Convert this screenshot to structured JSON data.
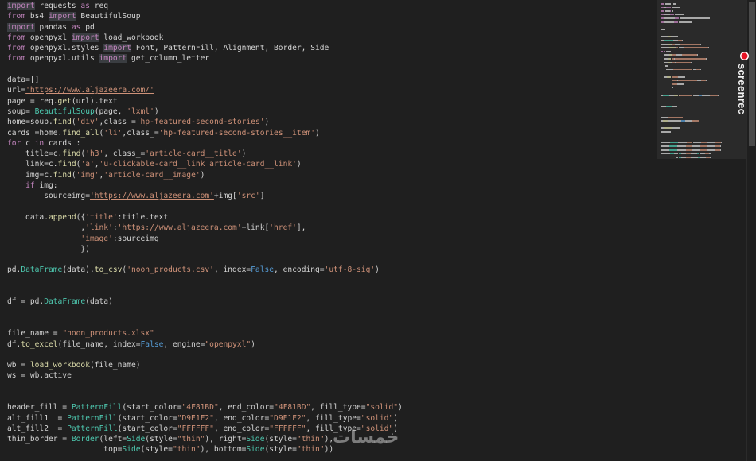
{
  "colors": {
    "background": "#1f1f1f",
    "keyword": "#c586c0",
    "string": "#ce9178",
    "function": "#dcdcaa",
    "variable": "#9cdcfe",
    "class": "#4ec9b0",
    "boolean": "#569cd6",
    "plain": "#d4d4d4",
    "rec_red": "#e81123"
  },
  "editor": {
    "lines": [
      [
        [
          "kw-hl",
          "import"
        ],
        [
          "plain",
          " requests "
        ],
        [
          "kw",
          "as"
        ],
        [
          "plain",
          " req"
        ]
      ],
      [
        [
          "kw",
          "from"
        ],
        [
          "plain",
          " bs4 "
        ],
        [
          "kw-hl",
          "import"
        ],
        [
          "plain",
          " BeautifulSoup"
        ]
      ],
      [
        [
          "kw-hl",
          "import"
        ],
        [
          "plain",
          " pandas "
        ],
        [
          "kw",
          "as"
        ],
        [
          "plain",
          " pd"
        ]
      ],
      [
        [
          "kw",
          "from"
        ],
        [
          "plain",
          " openpyxl "
        ],
        [
          "kw-hl",
          "import"
        ],
        [
          "plain",
          " load_workbook"
        ]
      ],
      [
        [
          "kw",
          "from"
        ],
        [
          "plain",
          " openpyxl.styles "
        ],
        [
          "kw-hl",
          "import"
        ],
        [
          "plain",
          " Font, PatternFill, Alignment, Border, Side"
        ]
      ],
      [
        [
          "kw",
          "from"
        ],
        [
          "plain",
          " openpyxl.utils "
        ],
        [
          "kw-hl",
          "import"
        ],
        [
          "plain",
          " get_column_letter"
        ]
      ],
      [],
      [
        [
          "plain",
          "data=[]"
        ]
      ],
      [
        [
          "plain",
          "url="
        ],
        [
          "url",
          "'https://www.aljazeera.com/'"
        ]
      ],
      [
        [
          "plain",
          "page = req."
        ],
        [
          "fn",
          "get"
        ],
        [
          "plain",
          "(url).text"
        ]
      ],
      [
        [
          "plain",
          "soup= "
        ],
        [
          "cls",
          "BeautifulSoup"
        ],
        [
          "plain",
          "(page, "
        ],
        [
          "str",
          "'lxml'"
        ],
        [
          "plain",
          ")"
        ]
      ],
      [
        [
          "plain",
          "home=soup."
        ],
        [
          "fn",
          "find"
        ],
        [
          "plain",
          "("
        ],
        [
          "str",
          "'div'"
        ],
        [
          "plain",
          ",class_="
        ],
        [
          "str",
          "'hp-featured-second-stories'"
        ],
        [
          "plain",
          ")"
        ]
      ],
      [
        [
          "plain",
          "cards =home."
        ],
        [
          "fn",
          "find_all"
        ],
        [
          "plain",
          "("
        ],
        [
          "str",
          "'li'"
        ],
        [
          "plain",
          ",class_="
        ],
        [
          "str",
          "'hp-featured-second-stories__item'"
        ],
        [
          "plain",
          ")"
        ]
      ],
      [
        [
          "kwflow",
          "for"
        ],
        [
          "plain",
          " c "
        ],
        [
          "kwflow",
          "in"
        ],
        [
          "plain",
          " cards :"
        ]
      ],
      [
        [
          "plain",
          "    title=c."
        ],
        [
          "fn",
          "find"
        ],
        [
          "plain",
          "("
        ],
        [
          "str",
          "'h3'"
        ],
        [
          "plain",
          ", class_="
        ],
        [
          "str",
          "'article-card__title'"
        ],
        [
          "plain",
          ")"
        ]
      ],
      [
        [
          "plain",
          "    link=c."
        ],
        [
          "fn",
          "find"
        ],
        [
          "plain",
          "("
        ],
        [
          "str",
          "'a'"
        ],
        [
          "plain",
          ","
        ],
        [
          "str",
          "'u-clickable-card__link article-card__link'"
        ],
        [
          "plain",
          ")"
        ]
      ],
      [
        [
          "plain",
          "    img=c."
        ],
        [
          "fn",
          "find"
        ],
        [
          "plain",
          "("
        ],
        [
          "str",
          "'img'"
        ],
        [
          "plain",
          ","
        ],
        [
          "str",
          "'article-card__image'"
        ],
        [
          "plain",
          ")"
        ]
      ],
      [
        [
          "plain",
          "    "
        ],
        [
          "kwflow",
          "if"
        ],
        [
          "plain",
          " img:"
        ]
      ],
      [
        [
          "plain",
          "        sourceimg="
        ],
        [
          "url",
          "'https://www.aljazeera.com'"
        ],
        [
          "plain",
          "+img["
        ],
        [
          "str",
          "'src'"
        ],
        [
          "plain",
          "]"
        ]
      ],
      [],
      [
        [
          "plain",
          "    data."
        ],
        [
          "fn",
          "append"
        ],
        [
          "plain",
          "({"
        ],
        [
          "str",
          "'title'"
        ],
        [
          "plain",
          ":title.text"
        ]
      ],
      [
        [
          "plain",
          "                ,"
        ],
        [
          "str",
          "'link'"
        ],
        [
          "plain",
          ":"
        ],
        [
          "url",
          "'https://www.aljazeera.com'"
        ],
        [
          "plain",
          "+link["
        ],
        [
          "str",
          "'href'"
        ],
        [
          "plain",
          "],"
        ]
      ],
      [
        [
          "plain",
          "                "
        ],
        [
          "str",
          "'image'"
        ],
        [
          "plain",
          ":sourceimg"
        ]
      ],
      [
        [
          "plain",
          "                })"
        ]
      ],
      [],
      [
        [
          "plain",
          "pd."
        ],
        [
          "cls",
          "DataFrame"
        ],
        [
          "plain",
          "(data)."
        ],
        [
          "fn",
          "to_csv"
        ],
        [
          "plain",
          "("
        ],
        [
          "str",
          "'noon_products.csv'"
        ],
        [
          "plain",
          ", index="
        ],
        [
          "bool",
          "False"
        ],
        [
          "plain",
          ", encoding="
        ],
        [
          "str",
          "'utf-8-sig'"
        ],
        [
          "plain",
          ")"
        ]
      ],
      [],
      [],
      [
        [
          "plain",
          "df = pd."
        ],
        [
          "cls",
          "DataFrame"
        ],
        [
          "plain",
          "(data)"
        ]
      ],
      [],
      [],
      [
        [
          "plain",
          "file_name = "
        ],
        [
          "str",
          "\"noon_products.xlsx\""
        ]
      ],
      [
        [
          "plain",
          "df."
        ],
        [
          "fn",
          "to_excel"
        ],
        [
          "plain",
          "(file_name, index="
        ],
        [
          "bool",
          "False"
        ],
        [
          "plain",
          ", engine="
        ],
        [
          "str",
          "\"openpyxl\""
        ],
        [
          "plain",
          ")"
        ]
      ],
      [],
      [
        [
          "plain",
          "wb = "
        ],
        [
          "fn",
          "load_workbook"
        ],
        [
          "plain",
          "(file_name)"
        ]
      ],
      [
        [
          "plain",
          "ws = wb.active"
        ]
      ],
      [],
      [],
      [
        [
          "plain",
          "header_fill = "
        ],
        [
          "cls",
          "PatternFill"
        ],
        [
          "plain",
          "(start_color="
        ],
        [
          "str",
          "\"4F81BD\""
        ],
        [
          "plain",
          ", end_color="
        ],
        [
          "str",
          "\"4F81BD\""
        ],
        [
          "plain",
          ", fill_type="
        ],
        [
          "str",
          "\"solid\""
        ],
        [
          "plain",
          ")"
        ]
      ],
      [
        [
          "plain",
          "alt_fill1  = "
        ],
        [
          "cls",
          "PatternFill"
        ],
        [
          "plain",
          "(start_color="
        ],
        [
          "str",
          "\"D9E1F2\""
        ],
        [
          "plain",
          ", end_color="
        ],
        [
          "str",
          "\"D9E1F2\""
        ],
        [
          "plain",
          ", fill_type="
        ],
        [
          "str",
          "\"solid\""
        ],
        [
          "plain",
          ")"
        ]
      ],
      [
        [
          "plain",
          "alt_fill2  = "
        ],
        [
          "cls",
          "PatternFill"
        ],
        [
          "plain",
          "(start_color="
        ],
        [
          "str",
          "\"FFFFFF\""
        ],
        [
          "plain",
          ", end_color="
        ],
        [
          "str",
          "\"FFFFFF\""
        ],
        [
          "plain",
          ", fill_type="
        ],
        [
          "str",
          "\"solid\""
        ],
        [
          "plain",
          ")"
        ]
      ],
      [
        [
          "plain",
          "thin_border = "
        ],
        [
          "cls",
          "Border"
        ],
        [
          "plain",
          "(left="
        ],
        [
          "cls",
          "Side"
        ],
        [
          "plain",
          "(style="
        ],
        [
          "str",
          "\"thin\""
        ],
        [
          "plain",
          "), right="
        ],
        [
          "cls",
          "Side"
        ],
        [
          "plain",
          "(style="
        ],
        [
          "str",
          "\"thin\""
        ],
        [
          "plain",
          "),"
        ]
      ],
      [
        [
          "plain",
          "                     top="
        ],
        [
          "cls",
          "Side"
        ],
        [
          "plain",
          "(style="
        ],
        [
          "str",
          "\"thin\""
        ],
        [
          "plain",
          "), bottom="
        ],
        [
          "cls",
          "Side"
        ],
        [
          "plain",
          "(style="
        ],
        [
          "str",
          "\"thin\""
        ],
        [
          "plain",
          "))"
        ]
      ]
    ]
  },
  "overlay": {
    "rec_text": "screenrec",
    "watermark": "خمسات"
  }
}
